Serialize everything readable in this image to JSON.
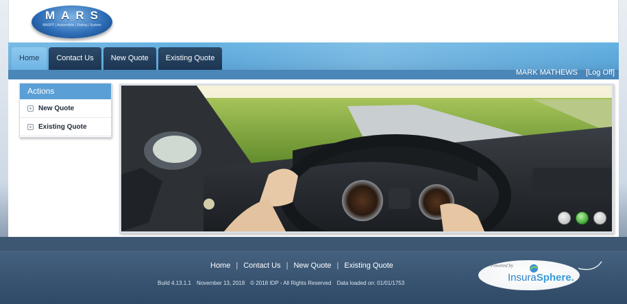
{
  "logo": {
    "title": "MARS",
    "subtitle": "MASPF | Automobile | Rating | System"
  },
  "nav": {
    "tabs": [
      {
        "label": "Home",
        "active": true
      },
      {
        "label": "Contact Us",
        "active": false
      },
      {
        "label": "New Quote",
        "active": false
      },
      {
        "label": "Existing Quote",
        "active": false
      }
    ],
    "user_name": "MARK MATHEWS",
    "logoff_label": "[Log Off]"
  },
  "actions": {
    "title": "Actions",
    "items": [
      {
        "label": "New Quote",
        "icon": "plus-square-icon"
      },
      {
        "label": "Existing Quote",
        "icon": "plus-square-icon"
      }
    ]
  },
  "carousel": {
    "slide_description_icon": "car-driving-photo",
    "dot_count": 3,
    "active_dot": 2
  },
  "footer": {
    "links": [
      "Home",
      "Contact Us",
      "New Quote",
      "Existing Quote"
    ],
    "separator": "|",
    "build": "Build 4.13.1.1",
    "date": "November 13, 2018",
    "copyright": "© 2018 IDP - All Rights Reserved",
    "data_loaded": "Data loaded on: 01/01/1753"
  },
  "powered": {
    "by": "Powered by",
    "brand_a": "Insura",
    "brand_b": "Sphere."
  },
  "colors": {
    "tab_dark": "#1c3552",
    "tab_active": "#6eb5e4",
    "actions_header": "#5a9fd6",
    "footer_bg": "#2f4966",
    "active_dot": "#2f9c2a"
  }
}
